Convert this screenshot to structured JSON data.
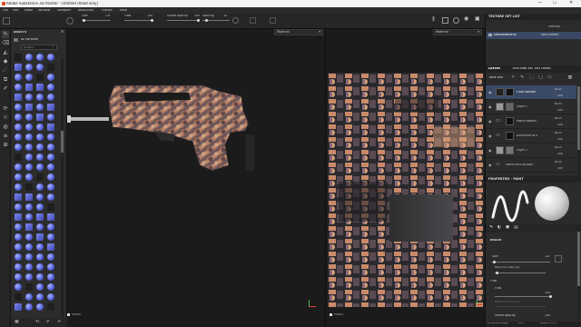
{
  "window": {
    "title": "Adobe Substance 3D Painter - Untitled (Read only)",
    "controls": [
      "—",
      "☐",
      "✕"
    ]
  },
  "menu": [
    "File",
    "Edit",
    "Mode",
    "Window",
    "Viewport",
    "JavaScript",
    "Python",
    "Help"
  ],
  "toolbar": {
    "size_label": "Size",
    "size_value": "1.8",
    "flow_label": "Flow",
    "flow_value": "100",
    "stroke_opacity_label": "Stroke opacity",
    "stroke_opacity_value": "100",
    "spacing_label": "Spacing",
    "spacing_value": "10"
  },
  "assets": {
    "title": "ASSETS",
    "all_libraries": "All libraries",
    "search_placeholder": "Surface",
    "thumbs_count_hint": "brush presets"
  },
  "viewport3d": {
    "material_select": "Material",
    "axis_label": "FAMAS"
  },
  "viewport2d": {
    "material_select": "Material",
    "axis_label": "FAMAS"
  },
  "texture_set_list": {
    "title": "TEXTURE SET LIST",
    "settings": "Settings",
    "item": "DefaultMaterial",
    "shader": "Main shader"
  },
  "layers_panel": {
    "tab_layers": "LAYERS",
    "tab_settings": "TEXTURE SET SETTINGS",
    "blend_mode": "Base colo",
    "layers": [
      {
        "name": "Fluid Stained",
        "blend": "Norm",
        "opacity": "100",
        "selected": true
      },
      {
        "name": "Layer 1",
        "blend": "Norm",
        "opacity": "100",
        "selected": false
      },
      {
        "name": "Fabric Baselin",
        "blend": "Norm",
        "opacity": "100",
        "selected": false
      },
      {
        "name": "Aluminum Bru",
        "blend": "Norm",
        "opacity": "100",
        "selected": false
      },
      {
        "name": "Layer 2",
        "blend": "Norm",
        "opacity": "100",
        "selected": false
      },
      {
        "name": "Fabric WOODLAND",
        "blend": "Norm",
        "opacity": "100",
        "selected": false
      }
    ]
  },
  "properties": {
    "title": "PROPERTIES - PAINT",
    "brush_section": "BRUSH",
    "size_label": "Size",
    "size_value": "1.8",
    "min_size_label": "Minimum Size (%)",
    "flow_section": "Flow",
    "flow_label": "Flow",
    "flow_value": "100",
    "min_flow_label": "Minimum Flow (%)",
    "stroke_opacity_label": "Stroke opacity",
    "stroke_opacity_value": "100"
  },
  "statusbar": {
    "cache": "Cache Disk Usage:",
    "cache_value": "65%",
    "version": "Version: 8.1.0"
  },
  "colors": {
    "accent": "#4f5bd5",
    "selection": "#3a4a66",
    "panel": "#2b2b2b",
    "viewport": "#1b1b1b"
  }
}
